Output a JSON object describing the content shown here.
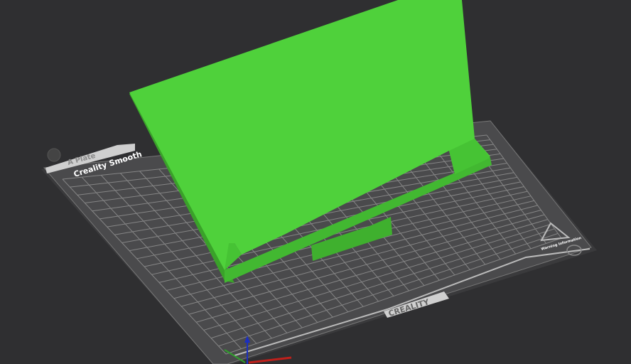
{
  "viewport": {
    "background": "#2f2f31",
    "plate": {
      "tab_label": "A Plate",
      "surface_name": "Creality Smooth",
      "brand_label": "CREALITY",
      "warning_label": "Warning Information",
      "plate_color": "#4a4a4c",
      "grid_color": "#9a9a9a"
    },
    "model": {
      "color": "#4fd13b",
      "shadow_color": "#3aa12a"
    },
    "axes": {
      "x_color": "#c0201b",
      "y_color": "#2fa02b",
      "z_color": "#1b2fc0"
    }
  }
}
